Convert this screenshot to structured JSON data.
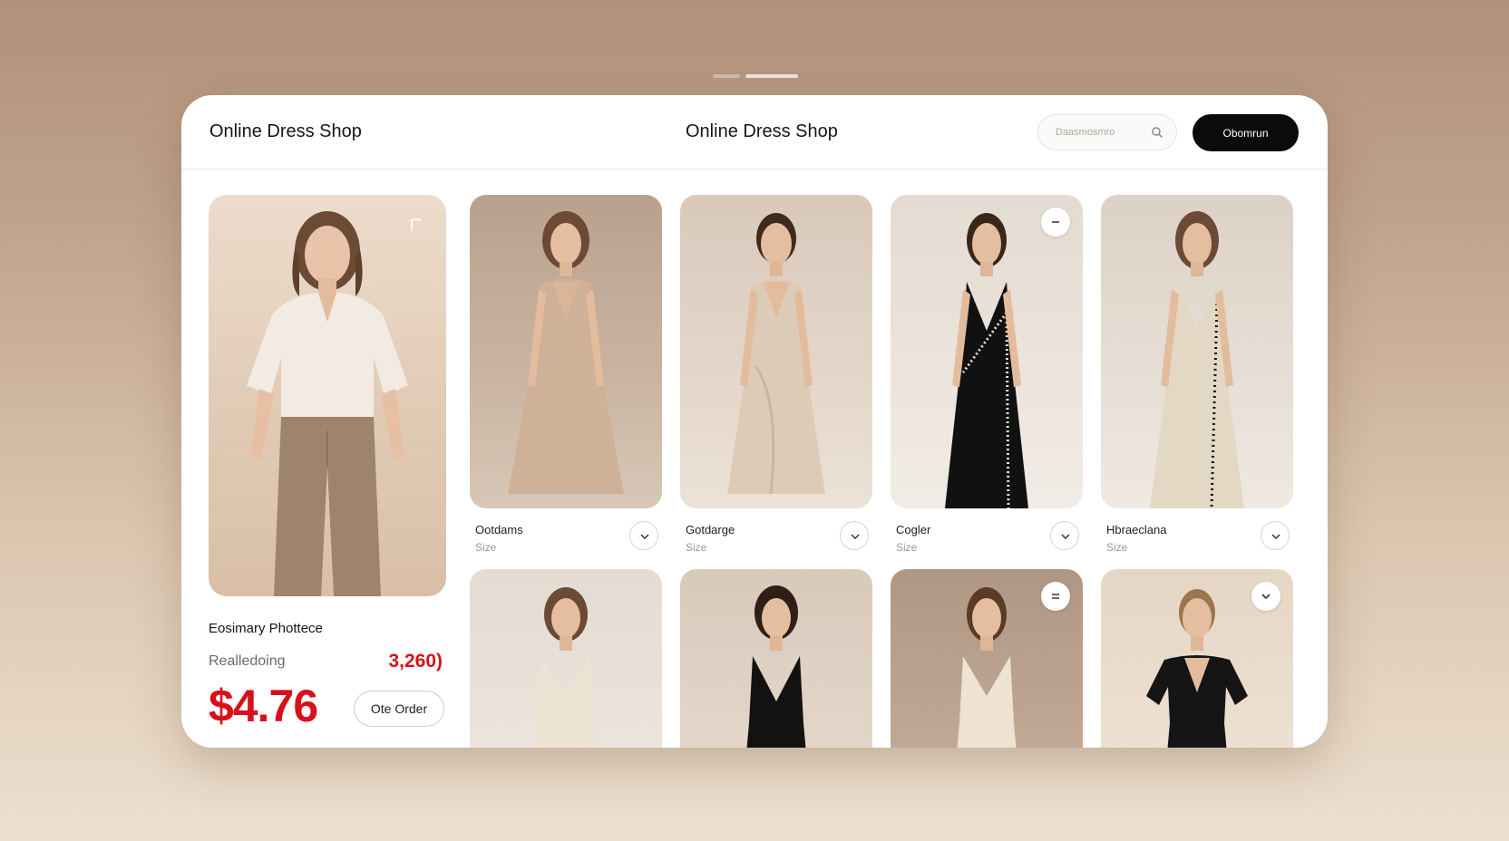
{
  "header": {
    "brand_left": "Online Dress Shop",
    "brand_center": "Online Dress Shop",
    "search_placeholder": "Daasmosmro",
    "cta_label": "Obomrun"
  },
  "featured": {
    "title": "Eosimary Phottece",
    "subtitle": "Realledoing",
    "count": "3,260)",
    "price": "$4.76",
    "order_label": "Ote Order"
  },
  "products": [
    {
      "name": "Ootdams",
      "size": "Size"
    },
    {
      "name": "Gotdarge",
      "size": "Size"
    },
    {
      "name": "Cogler",
      "size": "Size"
    },
    {
      "name": "Hbraeclana",
      "size": "Size"
    }
  ],
  "colors": {
    "accent_red": "#d7101b",
    "cta_black": "#0b0b0b",
    "page_bg": "#c3a68f"
  },
  "icons": [
    "search-icon",
    "flag-icon",
    "minus-icon",
    "equals-icon",
    "chevron-down-icon"
  ]
}
